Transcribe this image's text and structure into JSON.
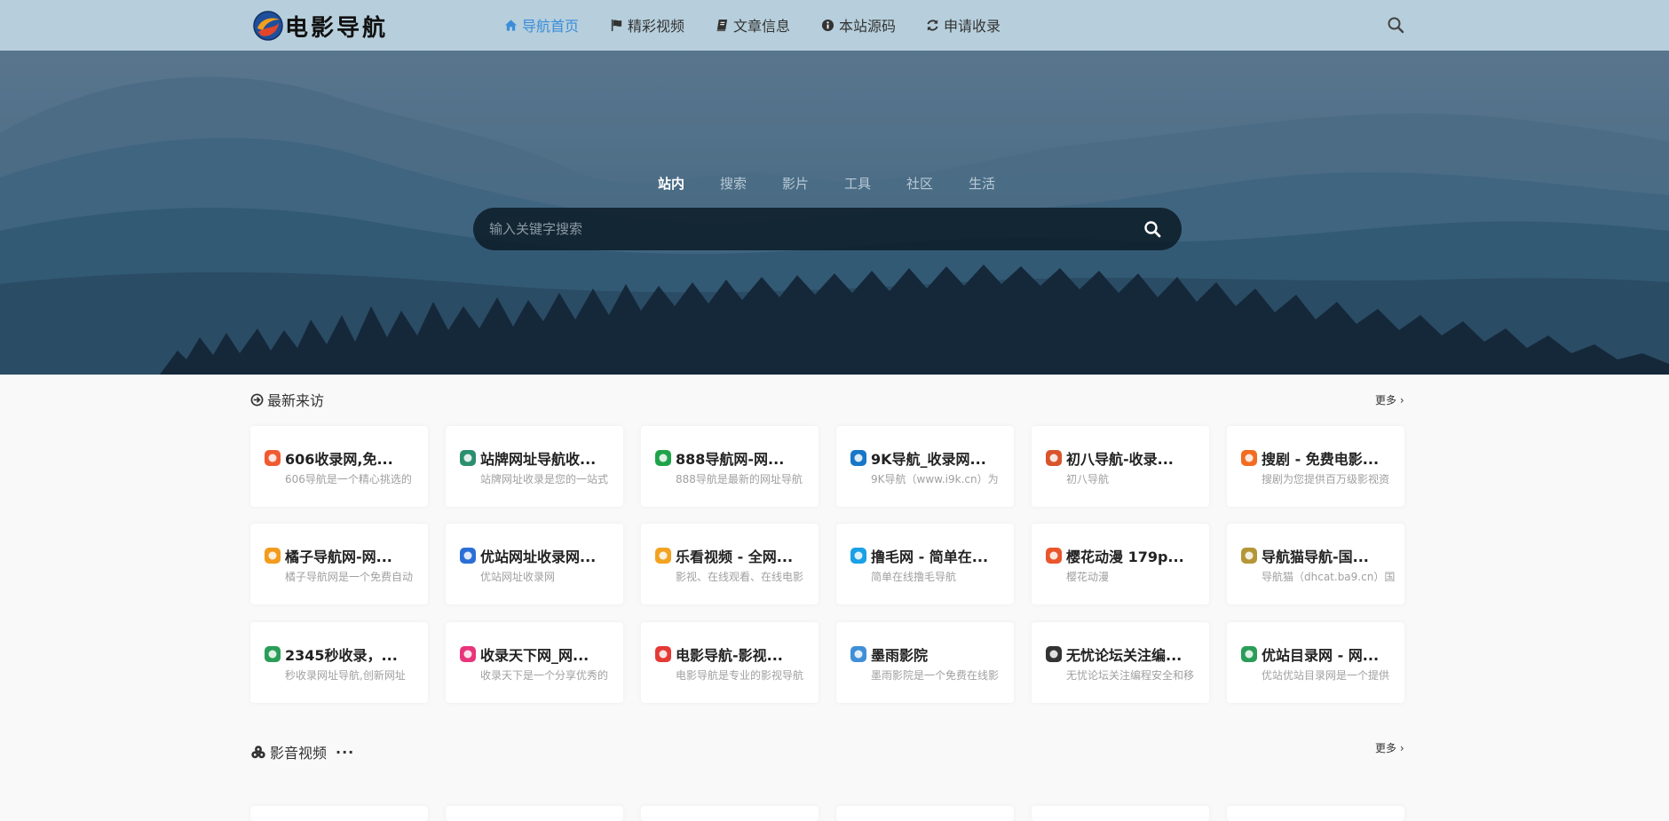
{
  "brand": {
    "name": "电影导航"
  },
  "nav": [
    {
      "label": "导航首页",
      "icon": "home-icon",
      "active": true
    },
    {
      "label": "精彩视频",
      "icon": "flag-icon"
    },
    {
      "label": "文章信息",
      "icon": "book-icon"
    },
    {
      "label": "本站源码",
      "icon": "info-icon"
    },
    {
      "label": "申请收录",
      "icon": "refresh-icon"
    }
  ],
  "search": {
    "tabs": [
      "站内",
      "搜索",
      "影片",
      "工具",
      "社区",
      "生活"
    ],
    "active_tab": "站内",
    "placeholder": "输入关键字搜索"
  },
  "recent": {
    "title": "最新来访",
    "more": "更多 ›",
    "cards": [
      {
        "title": "606收录网,免...",
        "desc": "606导航是一个精心挑选的",
        "icon": "icon-606",
        "color": "#f15a31"
      },
      {
        "title": "站牌网址导航收...",
        "desc": "站牌网址收录是您的一站式",
        "icon": "icon-cube",
        "color": "#2a8f6f"
      },
      {
        "title": "888导航网-网...",
        "desc": "888导航是最新的网址导航",
        "icon": "icon-shield",
        "color": "#1fa34a"
      },
      {
        "title": "9K导航_收录网...",
        "desc": "9K导航（www.i9k.cn）为",
        "icon": "icon-9k",
        "color": "#1877c9"
      },
      {
        "title": "初八导航-收录...",
        "desc": "初八导航",
        "icon": "icon-chuba",
        "color": "#d9532c"
      },
      {
        "title": "搜剧 - 免费电影...",
        "desc": "搜剧为您提供百万级影视资",
        "icon": "icon-souju",
        "color": "#f36c21"
      },
      {
        "title": "橘子导航网-网...",
        "desc": "橘子导航网是一个免费自动",
        "icon": "icon-orange",
        "color": "#f39b1d"
      },
      {
        "title": "优站网址收录网...",
        "desc": "优站网址收录网",
        "icon": "icon-youzhan",
        "color": "#2b6fd6"
      },
      {
        "title": "乐看视频 - 全网...",
        "desc": "影视、在线观看、在线电影",
        "icon": "icon-lekan",
        "color": "#f2a321"
      },
      {
        "title": "撸毛网 - 简单在...",
        "desc": "简单在线撸毛导航",
        "icon": "icon-lumao",
        "color": "#19a0e6"
      },
      {
        "title": "樱花动漫 179p...",
        "desc": "樱花动漫",
        "icon": "icon-yinghua",
        "color": "#e9562d"
      },
      {
        "title": "导航猫导航-国...",
        "desc": "导航猫（dhcat.ba9.cn）国",
        "icon": "icon-cat",
        "color": "#b59637"
      },
      {
        "title": "2345秒收录，...",
        "desc": "秒收录网址导航,创新网址",
        "icon": "icon-2345",
        "color": "#2a9d58"
      },
      {
        "title": "收录天下网_网...",
        "desc": "收录天下是一个分享优秀的",
        "icon": "icon-tianxia",
        "color": "#e8357a"
      },
      {
        "title": "电影导航-影视...",
        "desc": "电影导航是专业的影视导航",
        "icon": "icon-play",
        "color": "#e53935"
      },
      {
        "title": "墨雨影院",
        "desc": "墨雨影院是一个免费在线影",
        "icon": "icon-pinwheel",
        "color": "#3f8fd8"
      },
      {
        "title": "无忧论坛关注编...",
        "desc": "无忧论坛关注编程安全和移",
        "icon": "icon-it",
        "color": "#333333"
      },
      {
        "title": "优站目录网 - 网...",
        "desc": "优站优站目录网是一个提供",
        "icon": "icon-youzhan-dir",
        "color": "#2a9d58"
      }
    ]
  },
  "video": {
    "title": "影音视频",
    "dots": "···",
    "more": "更多 ›"
  }
}
